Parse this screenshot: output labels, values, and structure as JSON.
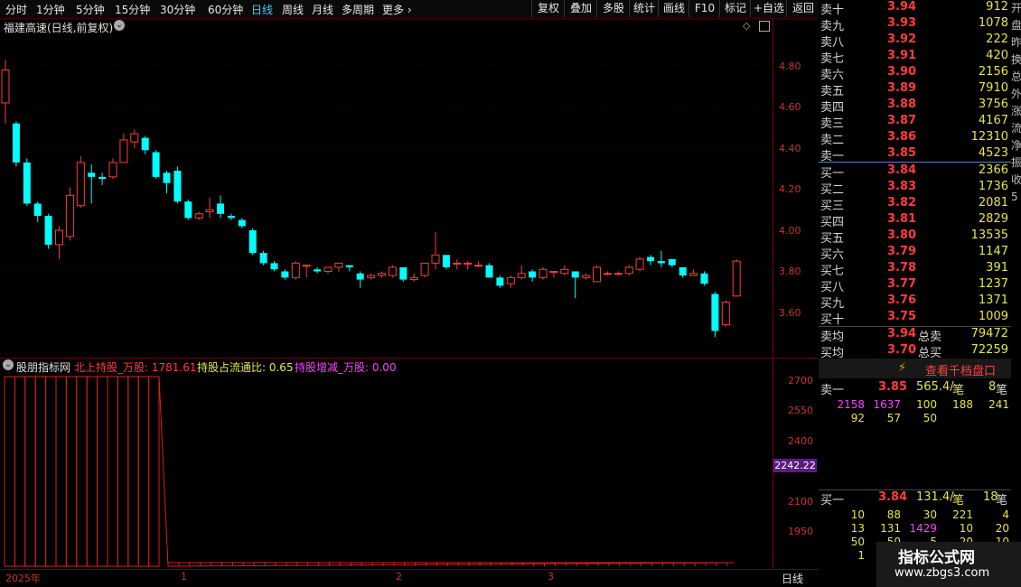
{
  "toolbar": {
    "periods": [
      "分时",
      "1分钟",
      "5分钟",
      "15分钟",
      "30分钟",
      "60分钟",
      "日线",
      "周线",
      "月线",
      "多周期",
      "更多 ›"
    ],
    "active_period": "日线",
    "buttons": [
      "复权",
      "叠加",
      "多股",
      "统计",
      "画线",
      "F10",
      "标记",
      "+自选",
      "返回"
    ]
  },
  "main_chart": {
    "title": "福建高速(日线,前复权)",
    "y_ticks": [
      "4.80",
      "4.60",
      "4.40",
      "4.20",
      "4.00",
      "3.80",
      "3.60"
    ],
    "colors": {
      "up": "#ff3c3c",
      "down": "#00ffff",
      "frame": "#7a0000"
    },
    "candles": [
      [
        4.62,
        4.78,
        4.83,
        4.52
      ],
      [
        4.52,
        4.33,
        4.53,
        4.31
      ],
      [
        4.33,
        4.13,
        4.35,
        4.12
      ],
      [
        4.13,
        4.07,
        4.14,
        4.04
      ],
      [
        4.07,
        3.93,
        4.08,
        3.91
      ],
      [
        3.93,
        4.0,
        4.02,
        3.86
      ],
      [
        3.97,
        4.17,
        4.21,
        3.95
      ],
      [
        4.12,
        4.33,
        4.36,
        4.11
      ],
      [
        4.28,
        4.26,
        4.32,
        4.13
      ],
      [
        4.26,
        4.25,
        4.28,
        4.22
      ],
      [
        4.26,
        4.33,
        4.35,
        4.25
      ],
      [
        4.33,
        4.44,
        4.47,
        4.33
      ],
      [
        4.43,
        4.47,
        4.49,
        4.4
      ],
      [
        4.45,
        4.39,
        4.46,
        4.37
      ],
      [
        4.38,
        4.26,
        4.39,
        4.25
      ],
      [
        4.28,
        4.23,
        4.29,
        4.18
      ],
      [
        4.29,
        4.14,
        4.31,
        4.13
      ],
      [
        4.14,
        4.06,
        4.15,
        4.05
      ],
      [
        4.06,
        4.08,
        4.09,
        4.05
      ],
      [
        4.09,
        4.1,
        4.16,
        4.06
      ],
      [
        4.13,
        4.08,
        4.17,
        4.06
      ],
      [
        4.07,
        4.06,
        4.08,
        4.05
      ],
      [
        4.05,
        4.02,
        4.06,
        4.01
      ],
      [
        4.0,
        3.89,
        4.01,
        3.88
      ],
      [
        3.89,
        3.84,
        3.9,
        3.83
      ],
      [
        3.84,
        3.81,
        3.85,
        3.8
      ],
      [
        3.8,
        3.77,
        3.81,
        3.76
      ],
      [
        3.77,
        3.84,
        3.85,
        3.76
      ],
      [
        3.83,
        3.83,
        3.83,
        3.77
      ],
      [
        3.81,
        3.8,
        3.82,
        3.79
      ],
      [
        3.8,
        3.82,
        3.82,
        3.79
      ],
      [
        3.82,
        3.84,
        3.84,
        3.8
      ],
      [
        3.83,
        3.82,
        3.83,
        3.8
      ],
      [
        3.79,
        3.76,
        3.8,
        3.72
      ],
      [
        3.77,
        3.78,
        3.79,
        3.76
      ],
      [
        3.78,
        3.79,
        3.8,
        3.77
      ],
      [
        3.78,
        3.82,
        3.83,
        3.77
      ],
      [
        3.82,
        3.76,
        3.82,
        3.75
      ],
      [
        3.76,
        3.77,
        3.79,
        3.75
      ],
      [
        3.78,
        3.84,
        3.84,
        3.77
      ],
      [
        3.84,
        3.88,
        3.99,
        3.81
      ],
      [
        3.88,
        3.82,
        3.88,
        3.81
      ],
      [
        3.84,
        3.84,
        3.86,
        3.81
      ],
      [
        3.84,
        3.84,
        3.85,
        3.81
      ],
      [
        3.83,
        3.83,
        3.85,
        3.82
      ],
      [
        3.83,
        3.77,
        3.84,
        3.77
      ],
      [
        3.77,
        3.73,
        3.78,
        3.72
      ],
      [
        3.74,
        3.77,
        3.78,
        3.72
      ],
      [
        3.77,
        3.79,
        3.83,
        3.76
      ],
      [
        3.8,
        3.77,
        3.81,
        3.75
      ],
      [
        3.77,
        3.81,
        3.82,
        3.76
      ],
      [
        3.8,
        3.8,
        3.8,
        3.77
      ],
      [
        3.79,
        3.81,
        3.83,
        3.78
      ],
      [
        3.8,
        3.77,
        3.8,
        3.67
      ],
      [
        3.77,
        3.78,
        3.79,
        3.76
      ],
      [
        3.75,
        3.82,
        3.83,
        3.75
      ],
      [
        3.79,
        3.79,
        3.8,
        3.78
      ],
      [
        3.79,
        3.79,
        3.8,
        3.78
      ],
      [
        3.79,
        3.82,
        3.83,
        3.78
      ],
      [
        3.81,
        3.86,
        3.87,
        3.8
      ],
      [
        3.87,
        3.85,
        3.88,
        3.83
      ],
      [
        3.85,
        3.84,
        3.9,
        3.82
      ],
      [
        3.86,
        3.83,
        3.86,
        3.82
      ],
      [
        3.82,
        3.78,
        3.82,
        3.77
      ],
      [
        3.78,
        3.79,
        3.81,
        3.78
      ],
      [
        3.79,
        3.74,
        3.8,
        3.73
      ],
      [
        3.69,
        3.51,
        3.7,
        3.48
      ],
      [
        3.54,
        3.65,
        3.66,
        3.53
      ],
      [
        3.68,
        3.85,
        3.86,
        3.68
      ]
    ]
  },
  "indicator": {
    "name": "股朋指标网",
    "legend": [
      {
        "label": "北上持股_万股: 1781.61",
        "color": "#ff3c3c"
      },
      {
        "label": "持股占流通比: 0.65",
        "color": "#e8e84a"
      },
      {
        "label": "持股增减_万股: 0.00",
        "color": "#ff40ff"
      }
    ],
    "y_ticks": [
      "2700",
      "2550",
      "2400",
      "2250",
      "2100",
      "1950"
    ],
    "current_value": "2242.22",
    "x_labels": [
      "2025年",
      "1",
      "2",
      "3"
    ],
    "period_label": "日线"
  },
  "quote_panel": {
    "sells": [
      {
        "label": "卖十",
        "price": "3.94",
        "vol": "912"
      },
      {
        "label": "卖九",
        "price": "3.93",
        "vol": "1078"
      },
      {
        "label": "卖八",
        "price": "3.92",
        "vol": "222"
      },
      {
        "label": "卖七",
        "price": "3.91",
        "vol": "420"
      },
      {
        "label": "卖六",
        "price": "3.90",
        "vol": "2156"
      },
      {
        "label": "卖五",
        "price": "3.89",
        "vol": "7910"
      },
      {
        "label": "卖四",
        "price": "3.88",
        "vol": "3756"
      },
      {
        "label": "卖三",
        "price": "3.87",
        "vol": "4167"
      },
      {
        "label": "卖二",
        "price": "3.86",
        "vol": "12310"
      },
      {
        "label": "卖一",
        "price": "3.85",
        "vol": "4523"
      }
    ],
    "buys": [
      {
        "label": "买一",
        "price": "3.84",
        "vol": "2366"
      },
      {
        "label": "买二",
        "price": "3.83",
        "vol": "1736"
      },
      {
        "label": "买三",
        "price": "3.82",
        "vol": "2081"
      },
      {
        "label": "买四",
        "price": "3.81",
        "vol": "2829"
      },
      {
        "label": "买五",
        "price": "3.80",
        "vol": "13535"
      },
      {
        "label": "买六",
        "price": "3.79",
        "vol": "1147"
      },
      {
        "label": "买七",
        "price": "3.78",
        "vol": "391"
      },
      {
        "label": "买八",
        "price": "3.77",
        "vol": "1237"
      },
      {
        "label": "买九",
        "price": "3.76",
        "vol": "1371"
      },
      {
        "label": "买十",
        "price": "3.75",
        "vol": "1009"
      }
    ],
    "avg_sell": {
      "label": "卖均",
      "price": "3.94",
      "total_label": "总卖",
      "total": "79472"
    },
    "avg_buy": {
      "label": "买均",
      "price": "3.70",
      "total_label": "总买",
      "total": "72259"
    },
    "qianjia_button": "查看千档盘口",
    "sell1_detail": {
      "label": "卖一",
      "price": "3.85",
      "avg": "565.4/",
      "unit": "笔",
      "count": "8",
      "unit2": "笔",
      "rows": [
        [
          "2158",
          "1637",
          "100",
          "188",
          "241"
        ],
        [
          "92",
          "57",
          "50",
          "",
          ""
        ]
      ]
    },
    "buy1_detail": {
      "label": "买一",
      "price": "3.84",
      "avg": "131.4/",
      "unit": "笔",
      "count": "18",
      "unit2": "笔",
      "rows": [
        [
          "10",
          "88",
          "30",
          "221",
          "4"
        ],
        [
          "13",
          "131",
          "1429",
          "10",
          "20"
        ],
        [
          "50",
          "50",
          "5",
          "20",
          "10"
        ],
        [
          "1",
          "",
          "",
          "",
          ""
        ]
      ]
    },
    "side_letters": [
      "开",
      "盘",
      "昨",
      "换",
      "总",
      "外",
      "涨",
      "流",
      "净",
      "振",
      "收",
      "5"
    ],
    "watermark_title": "指标公式网",
    "watermark_url": "www.zbgs3.com"
  }
}
